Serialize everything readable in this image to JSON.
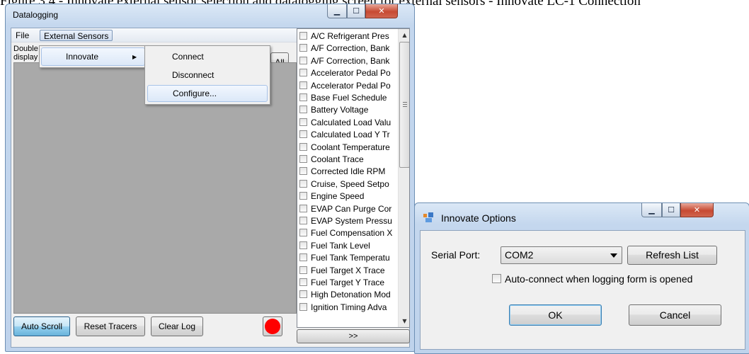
{
  "caption": "Figure 3.4 - Innovate external sensor selection and datalogging screen for external sensors - Innovate LC-1 Connection",
  "datalogging": {
    "title": "Datalogging",
    "menu": {
      "file": "File",
      "external_sensors": "External Sensors"
    },
    "hint_line1": "Double",
    "hint_line2": "display",
    "all_button": "All",
    "buttons": {
      "auto_scroll": "Auto Scroll",
      "reset_tracers": "Reset Tracers",
      "clear_log": "Clear Log"
    },
    "more_button": ">>",
    "sensors": [
      "A/C Refrigerant Pres",
      "A/F Correction, Bank",
      "A/F Correction, Bank",
      "Accelerator Pedal Po",
      "Accelerator Pedal Po",
      "Base Fuel Schedule",
      "Battery Voltage",
      "Calculated Load Valu",
      "Calculated Load Y Tr",
      "Coolant Temperature",
      "Coolant Trace",
      "Corrected Idle RPM",
      "Cruise, Speed Setpo",
      "Engine Speed",
      "EVAP Can Purge Cor",
      "EVAP System Pressu",
      "Fuel Compensation X",
      "Fuel Tank Level",
      "Fuel Tank Temperatu",
      "Fuel Target X Trace",
      "Fuel Target Y Trace",
      "High Detonation Mod",
      "Ignition Timing Adva"
    ]
  },
  "menus": {
    "external_sensors_items": [
      "Innovate"
    ],
    "innovate_items": [
      "Connect",
      "Disconnect",
      "Configure..."
    ]
  },
  "innovate_options": {
    "title": "Innovate Options",
    "serial_port_label": "Serial Port:",
    "serial_port_value": "COM2",
    "refresh_button": "Refresh List",
    "auto_connect_label": "Auto-connect when logging form is opened",
    "auto_connect_checked": false,
    "ok_button": "OK",
    "cancel_button": "Cancel"
  },
  "colors": {
    "plot_background": "#a9a9a9",
    "record_button": "#ff0000",
    "title_bar": "#c4d7ee",
    "close_button": "#c74a32"
  }
}
